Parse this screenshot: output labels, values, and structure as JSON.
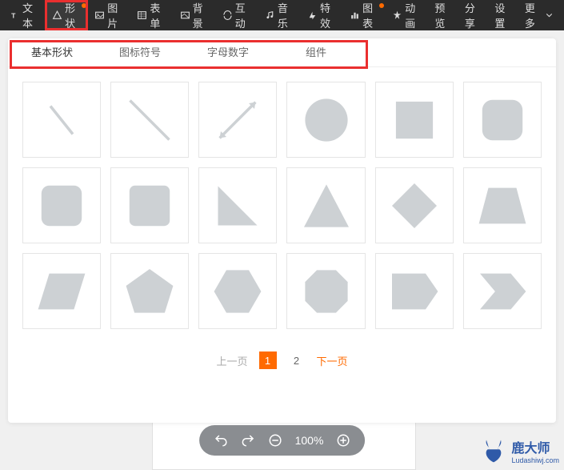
{
  "toolbar": {
    "items": [
      {
        "label": "文本",
        "icon": "text",
        "dot": false,
        "active": false
      },
      {
        "label": "形状",
        "icon": "shape",
        "dot": true,
        "active": true
      },
      {
        "label": "图片",
        "icon": "image",
        "dot": false,
        "active": false
      },
      {
        "label": "表单",
        "icon": "form",
        "dot": false,
        "active": false
      },
      {
        "label": "背景",
        "icon": "bg",
        "dot": false,
        "active": false
      },
      {
        "label": "互动",
        "icon": "interact",
        "dot": false,
        "active": false
      },
      {
        "label": "音乐",
        "icon": "music",
        "dot": false,
        "active": false
      },
      {
        "label": "特效",
        "icon": "fx",
        "dot": false,
        "active": false
      },
      {
        "label": "图表",
        "icon": "chart",
        "dot": true,
        "active": false
      },
      {
        "label": "动画",
        "icon": "anim",
        "dot": false,
        "active": false
      },
      {
        "label": "预览",
        "icon": "",
        "dot": false,
        "active": false
      },
      {
        "label": "分享",
        "icon": "",
        "dot": false,
        "active": false
      },
      {
        "label": "设置",
        "icon": "",
        "dot": false,
        "active": false
      },
      {
        "label": "更多",
        "icon": "",
        "dot": false,
        "active": false
      }
    ]
  },
  "tabs": {
    "items": [
      {
        "label": "基本形状",
        "active": true
      },
      {
        "label": "图标符号",
        "active": false
      },
      {
        "label": "字母数字",
        "active": false
      },
      {
        "label": "组件",
        "active": false
      }
    ]
  },
  "shapes": [
    {
      "name": "line-short"
    },
    {
      "name": "line-long"
    },
    {
      "name": "arrow-double"
    },
    {
      "name": "circle"
    },
    {
      "name": "square"
    },
    {
      "name": "rounded-square"
    },
    {
      "name": "rounded-square-2"
    },
    {
      "name": "rounded-square-3"
    },
    {
      "name": "triangle-right"
    },
    {
      "name": "triangle"
    },
    {
      "name": "diamond"
    },
    {
      "name": "trapezoid"
    },
    {
      "name": "parallelogram"
    },
    {
      "name": "pentagon"
    },
    {
      "name": "hexagon"
    },
    {
      "name": "octagon"
    },
    {
      "name": "pentagon-arrow"
    },
    {
      "name": "chevron"
    }
  ],
  "pagination": {
    "prev": "上一页",
    "pages": [
      "1",
      "2"
    ],
    "current": 1,
    "next": "下一页"
  },
  "bottomBar": {
    "zoom": "100%"
  },
  "watermark": {
    "brand": "鹿大师",
    "url": "Ludashiwj.com"
  }
}
